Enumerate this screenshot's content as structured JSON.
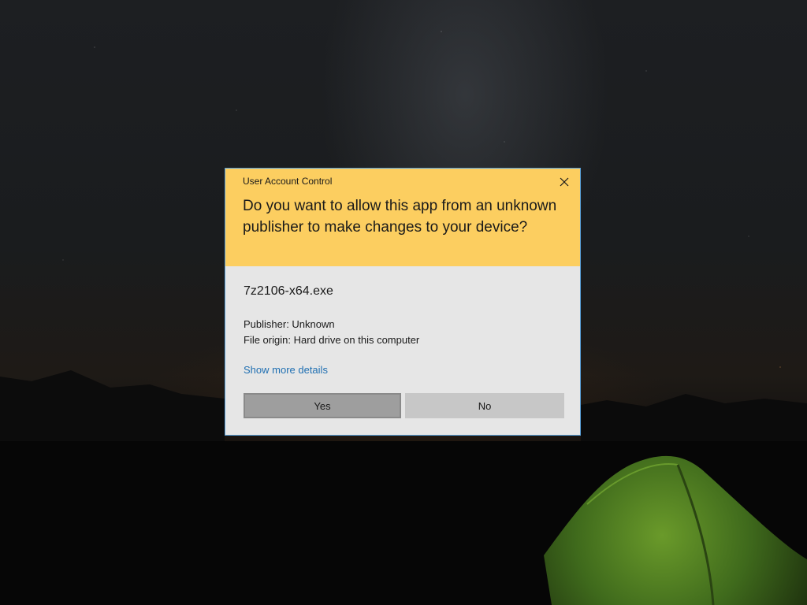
{
  "desktop": {
    "background": "night sky with mountains and green tent"
  },
  "dialog": {
    "title": "User Account Control",
    "question": "Do you want to allow this app from an unknown publisher to make changes to your device?",
    "app_name": "7z2106-x64.exe",
    "publisher": "Publisher: Unknown",
    "file_origin": "File origin: Hard drive on this computer",
    "details_link": "Show more details",
    "yes_label": "Yes",
    "no_label": "No",
    "close_icon": "close-icon"
  },
  "colors": {
    "header": "#fcce60",
    "body": "#e6e6e6",
    "border": "#5aa0d8",
    "link": "#1f6fb2",
    "yes_button": "#9e9e9e",
    "no_button": "#c7c7c7"
  }
}
